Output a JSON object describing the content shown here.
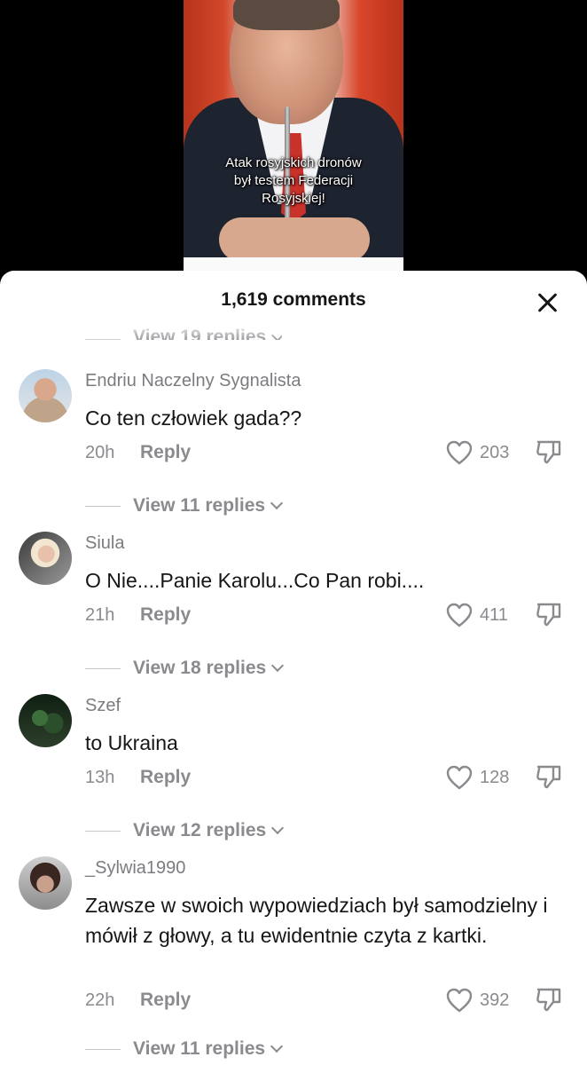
{
  "video": {
    "caption_lines": [
      "Atak rosyjskich dronów",
      "był testem Federacji",
      "Rosyjskiej!"
    ]
  },
  "sheet": {
    "title": "1,619 comments",
    "previous_thread_replies": "View 19 replies"
  },
  "icons": {
    "close": "close-icon",
    "like": "heart-outline-icon",
    "dislike": "thumbs-down-icon",
    "expand": "chevron-down-icon"
  },
  "colors": {
    "sheet_background": "#ffffff",
    "primary_text": "#161616",
    "secondary_text": "#8a8a8f"
  },
  "comments": [
    {
      "username": "Endriu Naczelny Sygnalista",
      "text": "Co ten człowiek gada??",
      "time": "20h",
      "reply_label": "Reply",
      "likes": "203",
      "replies_label": "View 11 replies"
    },
    {
      "username": "Siula",
      "text": "O Nie....Panie Karolu...Co Pan robi....",
      "time": "21h",
      "reply_label": "Reply",
      "likes": "411",
      "replies_label": "View 18 replies"
    },
    {
      "username": "Szef",
      "text": "to Ukraina",
      "time": "13h",
      "reply_label": "Reply",
      "likes": "128",
      "replies_label": "View 12 replies"
    },
    {
      "username": "_Sylwia1990",
      "text": "Zawsze w swoich wypowiedziach był samodzielny i mówił z głowy, a tu ewidentnie czyta z kartki.",
      "time": "22h",
      "reply_label": "Reply",
      "likes": "392",
      "replies_label": "View 11 replies"
    }
  ]
}
